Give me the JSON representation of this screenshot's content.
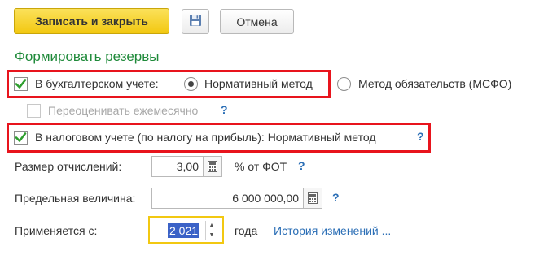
{
  "toolbar": {
    "save_close_label": "Записать и закрыть",
    "save_icon": "floppy-disk-icon",
    "cancel_label": "Отмена"
  },
  "section": {
    "title": "Формировать резервы"
  },
  "accounting": {
    "checkbox_label": "В бухгалтерском учете:",
    "checked": true,
    "radio_options": [
      {
        "label": "Нормативный метод",
        "selected": true
      },
      {
        "label": "Метод обязательств (МСФО)",
        "selected": false
      }
    ],
    "revalue_label": "Переоценивать ежемесячно",
    "revalue_checked": false,
    "revalue_enabled": false,
    "help": "?"
  },
  "tax": {
    "checkbox_label": "В налоговом учете (по налогу на прибыль): Нормативный метод",
    "checked": true,
    "help": "?"
  },
  "deduction": {
    "label": "Размер отчислений:",
    "value": "3,00",
    "unit": "% от ФОТ",
    "help": "?"
  },
  "limit": {
    "label": "Предельная величина:",
    "value": "6 000 000,00",
    "help": "?"
  },
  "applies_from": {
    "label": "Применяется с:",
    "year": "2 021",
    "unit": "года",
    "history_link": "История изменений ..."
  },
  "colors": {
    "accent_yellow": "#f2c811",
    "section_green": "#1f8a3a",
    "highlight_red": "#e8141d",
    "link_blue": "#2c6fb6",
    "check_green": "#2e9e2e"
  }
}
